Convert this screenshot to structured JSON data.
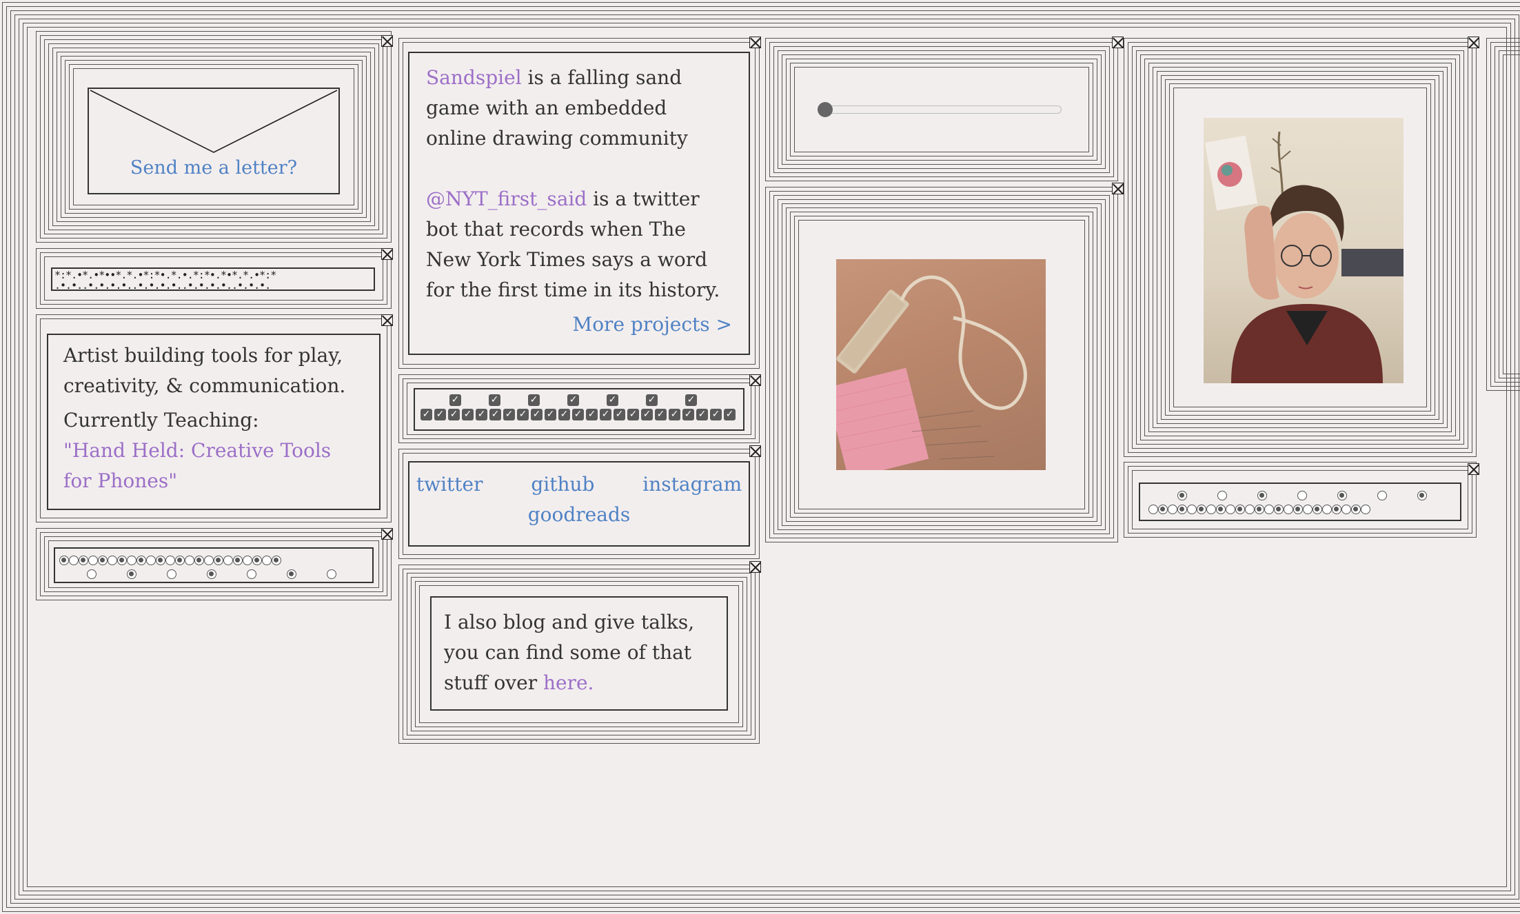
{
  "letter": {
    "label": "Send me a letter?"
  },
  "dots_strip": {
    "row1": "*:*.•*.•*••*.*.•*:*•.*.•.*:*•.*•*.*.•*:*",
    "row2": ".•.•..•.•.•.•..•.•.•.•..•.•.•.•..•.•.•."
  },
  "bio": {
    "line": "Artist building tools for play, creativity, & communication.",
    "teaching_label": "Currently Teaching:",
    "teaching_link": "\"Hand Held: Creative Tools for Phones\""
  },
  "projects": {
    "sandspiel_name": "Sandspiel",
    "sandspiel_desc": " is a falling sand game with an embedded online drawing community",
    "nyt_name": "@NYT_first_said",
    "nyt_desc": " is a twitter bot that records when The New York Times says a word for the first time in its history.",
    "more": "More projects >"
  },
  "links": {
    "twitter": "twitter",
    "github": "github",
    "instagram": "instagram",
    "goodreads": "goodreads"
  },
  "blog": {
    "text": "I also blog and give talks, you can find some of that stuff over ",
    "link": "here."
  },
  "slider": {
    "value": 0
  },
  "photos": {
    "power_strip": "photo of power strip on paper",
    "portrait": "photo of person with hand on head"
  }
}
